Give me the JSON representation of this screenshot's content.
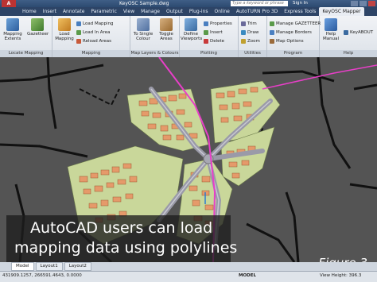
{
  "titlebar": {
    "app_button": "A",
    "title": "KeyOSC Sample.dwg",
    "search_placeholder": "Type a keyword or phrase",
    "sign_in": "Sign In"
  },
  "tabs": [
    "Home",
    "Insert",
    "Annotate",
    "Parametric",
    "View",
    "Manage",
    "Output",
    "Plug-ins",
    "Online",
    "AutoTURN Pro 3D",
    "Express Tools",
    "KeyOSC Mapper"
  ],
  "active_tab": "KeyOSC Mapper",
  "ribbon": {
    "locate_mapping": {
      "title": "Locate Mapping",
      "buttons": [
        {
          "label": "Mapping Extents",
          "icon": "mapping-extents-icon"
        },
        {
          "label": "Gazetteer",
          "icon": "gazetteer-icon"
        }
      ]
    },
    "mapping": {
      "title": "Mapping",
      "big": {
        "label": "Load Mapping",
        "icon": "load-mapping-icon"
      },
      "small": [
        "Load Mapping",
        "Load In Area",
        "Reload Areas"
      ]
    },
    "map_layers": {
      "title": "Map Layers & Colours",
      "buttons": [
        {
          "label": "To Single Colour",
          "icon": "single-colour-icon"
        },
        {
          "label": "Toggle Areas",
          "icon": "toggle-areas-icon"
        }
      ]
    },
    "plotting": {
      "title": "Plotting",
      "big": {
        "label": "Define Viewports",
        "icon": "define-viewports-icon"
      },
      "small": [
        "Properties",
        "Insert",
        "Delete"
      ]
    },
    "utilities": {
      "title": "Utilities",
      "small": [
        "Trim",
        "Draw",
        "Zoom"
      ]
    },
    "program": {
      "title": "Program",
      "small": [
        "Manage GAZETTEER",
        "Manage Borders",
        "Map Options"
      ]
    },
    "help": {
      "title": "Help",
      "big": {
        "label": "Help Manual",
        "icon": "help-manual-icon"
      },
      "small": [
        "KeyABOUT"
      ]
    }
  },
  "caption": {
    "line1": "AutoCAD users can load",
    "line2": "mapping data using polylines"
  },
  "figure_label": "Figure 3",
  "layout_tabs": [
    "Model",
    "Layout1",
    "Layout2"
  ],
  "active_layout": "Model",
  "status": {
    "coords": "431909.1257, 266591.4643, 0.0000",
    "model": "MODEL",
    "view_height": "View Height: 396.3"
  },
  "colors": {
    "accent": "#2d4466",
    "map_fill": "#c9d79a",
    "buildings": "#e59a6a",
    "roads": "#9a9aa8",
    "pink_line": "#e83fc8"
  }
}
